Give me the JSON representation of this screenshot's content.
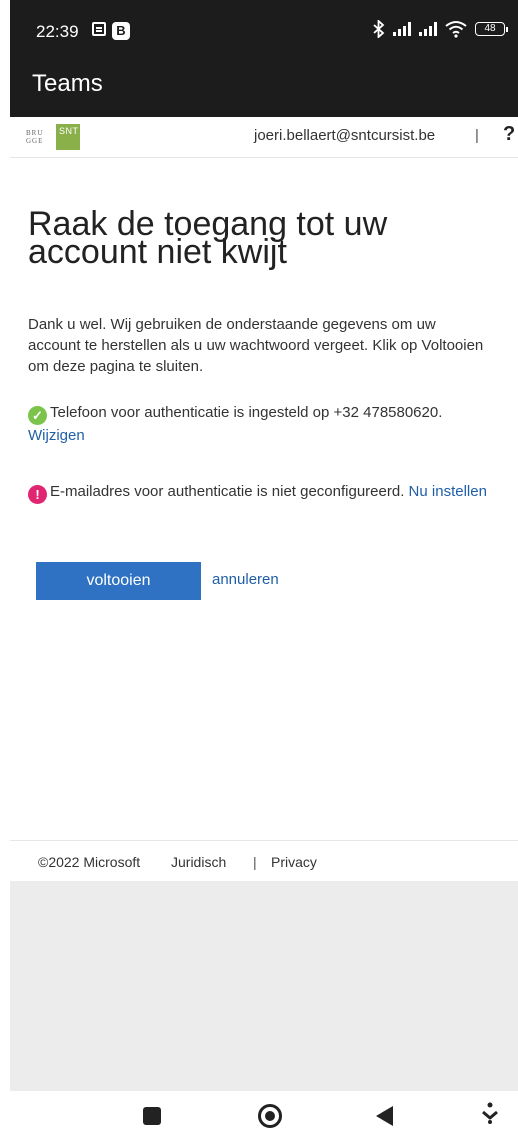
{
  "status_bar": {
    "time": "22:39",
    "badge": "B",
    "battery": "48",
    "icons": [
      "notification-icon",
      "b-app-icon",
      "bluetooth-icon",
      "signal-icon",
      "signal-icon",
      "wifi-icon",
      "battery-icon"
    ]
  },
  "app": {
    "title": "Teams"
  },
  "header": {
    "logo_line1": "BRU",
    "logo_line2": "GGE",
    "logo_snt": "SNT",
    "email": "joeri.bellaert@sntcursist.be",
    "separator": "|",
    "help": "?"
  },
  "main": {
    "title": "Raak de toegang tot uw account niet kwijt",
    "intro": "Dank u wel. Wij gebruiken de onderstaande gegevens om uw account te herstellen als u uw wachtwoord vergeet. Klik op Voltooien om deze pagina te sluiten.",
    "phone_status": "Telefoon voor authenticatie is ingesteld op +32 478580620.",
    "phone_action": "Wijzigen",
    "email_status": "E-mailadres voor authenticatie is niet geconfigureerd.",
    "email_action": "Nu instellen",
    "finish_button": "voltooien",
    "cancel_link": "annuleren"
  },
  "footer": {
    "copyright": "©2022 Microsoft",
    "legal": "Juridisch",
    "separator": "|",
    "privacy": "Privacy"
  },
  "colors": {
    "primary": "#2f72c4",
    "link": "#1f5fa8",
    "success": "#7cc34b",
    "warning": "#e02670",
    "topbar": "#1c1c1c"
  }
}
